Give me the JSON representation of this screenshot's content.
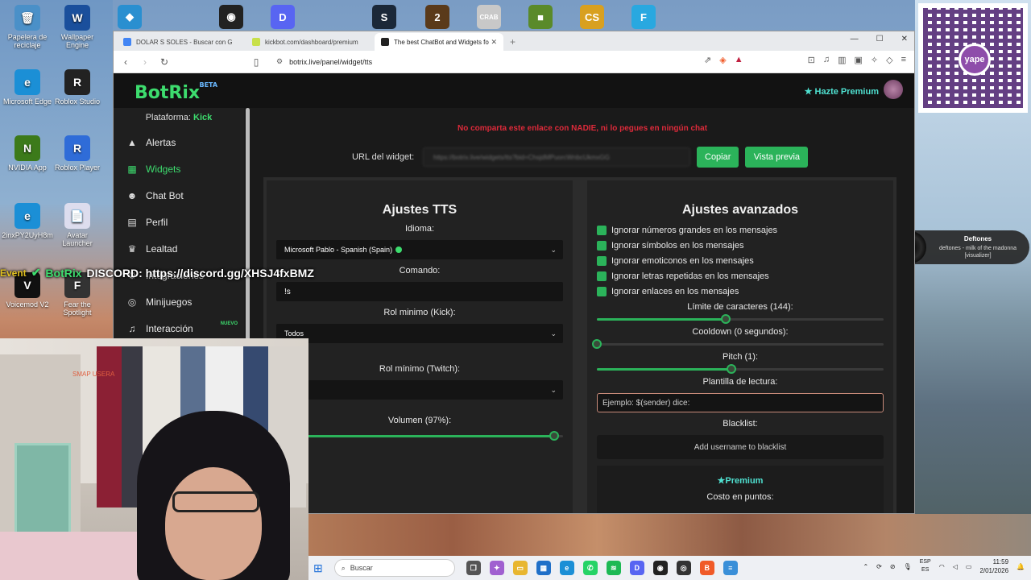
{
  "desktop": {
    "left_icons": [
      {
        "label": "Papelera de reciclaje",
        "color": "#4a90c8",
        "glyph": "🗑"
      },
      {
        "label": "Wallpaper Engine",
        "color": "#1a4f9c",
        "glyph": "W"
      },
      {
        "label": "Microsoft Edge",
        "color": "#1b8fd6",
        "glyph": "e"
      },
      {
        "label": "Roblox Studio",
        "color": "#222",
        "glyph": "R"
      },
      {
        "label": "NVIDIA App",
        "color": "#3c7a1a",
        "glyph": "N"
      },
      {
        "label": "Roblox Player",
        "color": "#2f6cd8",
        "glyph": "R"
      },
      {
        "label": "2inxPY2UyH8m",
        "color": "#1b8fd6",
        "glyph": "e"
      },
      {
        "label": "Avatar Launcher",
        "color": "#dde",
        "glyph": "📄"
      },
      {
        "label": "Voicemod V2",
        "color": "#111",
        "glyph": "V"
      },
      {
        "label": "Fear the Spotlight",
        "color": "#333",
        "glyph": "F"
      }
    ],
    "top_icons": [
      {
        "name": "kick-app-icon",
        "color": "#2a8fd0",
        "glyph": "◆"
      },
      {
        "name": "obs-icon",
        "color": "#222",
        "glyph": "◉"
      },
      {
        "name": "discord-icon",
        "color": "#5865f2",
        "glyph": "D"
      },
      {
        "name": "steam-icon",
        "color": "#1b2838",
        "glyph": "S"
      },
      {
        "name": "game-icon",
        "color": "#5a3a1a",
        "glyph": "2"
      },
      {
        "name": "crab-game-icon",
        "color": "#c8c8c8",
        "glyph": "CRAB"
      },
      {
        "name": "minecraft-icon",
        "color": "#5a8a2a",
        "glyph": "■"
      },
      {
        "name": "counter-strike-icon",
        "color": "#d8a020",
        "glyph": "CS"
      },
      {
        "name": "fortnite-icon",
        "color": "#29a8e0",
        "glyph": "F"
      }
    ]
  },
  "overlay": {
    "event": "Event",
    "brand": "BotRix",
    "text": "DISCORD: https://discord.gg/XHSJ4fxBMZ",
    "partial": "Integraciones"
  },
  "music": {
    "title": "Deftones",
    "subtitle": "deftones - milk of the madonna [visualizer]"
  },
  "qr": {
    "logo": "yape"
  },
  "browser": {
    "tabs": [
      {
        "label": "DOLAR S SOLES - Buscar con Google",
        "color": "#4285f4"
      },
      {
        "label": "kickbot.com/dashboard/premium",
        "color": "#c8e04a"
      },
      {
        "label": "The best ChatBot and Widgets fo",
        "color": "#222",
        "active": true
      }
    ],
    "url": "botrix.live/panel/widget/tts"
  },
  "app": {
    "logo": "BotRix",
    "beta": "BETA",
    "premium_label": "Hazte Premium",
    "platform_label": "Plataforma:",
    "platform_value": "Kick",
    "nav": [
      {
        "label": "Alertas",
        "icon": "▲"
      },
      {
        "label": "Widgets",
        "icon": "▦",
        "active": true
      },
      {
        "label": "Chat Bot",
        "icon": "☻"
      },
      {
        "label": "Perfil",
        "icon": "▤"
      },
      {
        "label": "Lealtad",
        "icon": "♛"
      },
      {
        "label": "Integraciones",
        "icon": "⚙"
      },
      {
        "label": "Minijuegos",
        "icon": "◎"
      },
      {
        "label": "Interacción",
        "icon": "♫",
        "badge": "NUEVO"
      }
    ],
    "warning": "No comparta este enlace con NADIE, ni lo pegues en ningún chat",
    "url_label": "URL del widget:",
    "url_value": "https://botrix.live/widgets/tts?bid=ChsjdMPuorcWnbcUkmxGG",
    "copy_btn": "Copiar",
    "preview_btn": "Vista previa",
    "tts": {
      "title": "Ajustes TTS",
      "language_label": "Idioma:",
      "language_value": "Microsoft Pablo - Spanish (Spain)",
      "command_label": "Comando:",
      "command_value": "!s",
      "role_kick_label": "Rol minimo (Kick):",
      "role_kick_value": "Todos",
      "role_twitch_label": "Rol mínimo (Twitch):",
      "role_twitch_value": "",
      "volume_label": "Volumen (97%):",
      "volume_fraction": 0.97
    },
    "advanced": {
      "title": "Ajustes avanzados",
      "checks": [
        "Ignorar números grandes en los mensajes",
        "Ignorar símbolos en los mensajes",
        "Ignorar emoticonos en los mensajes",
        "Ignorar letras repetidas en los mensajes",
        "Ignorar enlaces en los mensajes"
      ],
      "char_limit_label": "Límite de caracteres (144):",
      "char_limit_fraction": 0.45,
      "cooldown_label": "Cooldown (0 segundos):",
      "cooldown_fraction": 0.0,
      "pitch_label": "Pitch (1):",
      "pitch_fraction": 0.47,
      "template_label": "Plantilla de lectura:",
      "template_placeholder": "Ejemplo: $(sender) dice:",
      "blacklist_label": "Blacklist:",
      "blacklist_btn": "Add username to blacklist",
      "premium_title": "Premium",
      "points_label": "Costo en puntos:"
    }
  },
  "webcam": {
    "sign": "SMAP USERA"
  },
  "taskbar": {
    "search_placeholder": "Buscar",
    "apps": [
      {
        "name": "task-view-icon",
        "color": "#555",
        "glyph": "❐"
      },
      {
        "name": "copilot-icon",
        "color": "#a060d0",
        "glyph": "✦"
      },
      {
        "name": "file-explorer-icon",
        "color": "#e8b630",
        "glyph": "▭"
      },
      {
        "name": "store-icon",
        "color": "#2070c8",
        "glyph": "▦"
      },
      {
        "name": "edge-icon",
        "color": "#1b8fd6",
        "glyph": "e"
      },
      {
        "name": "whatsapp-icon",
        "color": "#25d366",
        "glyph": "✆"
      },
      {
        "name": "spotify-icon",
        "color": "#1db954",
        "glyph": "≋"
      },
      {
        "name": "discord-taskbar-icon",
        "color": "#5865f2",
        "glyph": "D"
      },
      {
        "name": "obs-taskbar-icon",
        "color": "#222",
        "glyph": "◉"
      },
      {
        "name": "game-taskbar-icon",
        "color": "#333",
        "glyph": "◎"
      },
      {
        "name": "brave-icon",
        "color": "#f05a28",
        "glyph": "B"
      },
      {
        "name": "notepad-icon",
        "color": "#3a8fd8",
        "glyph": "≡"
      }
    ],
    "badge_whatsapp": "59",
    "lang": "ESP",
    "lang2": "ES",
    "time": "11:59",
    "date": "2/01/2026"
  }
}
